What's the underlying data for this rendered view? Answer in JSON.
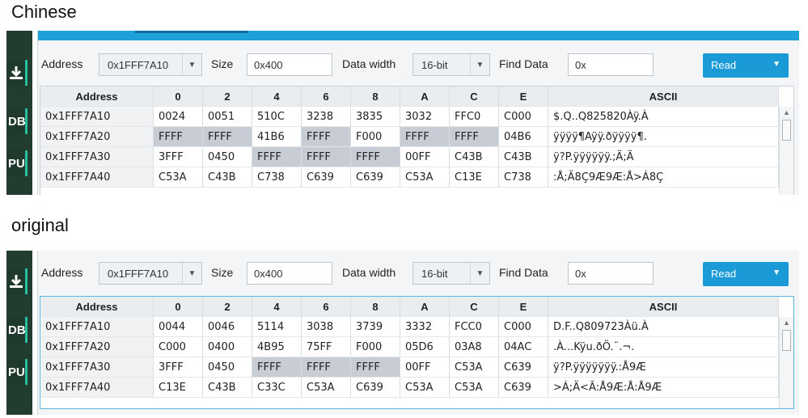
{
  "captions": {
    "top": "Chinese",
    "bottom": "original"
  },
  "sidebar_labels": {
    "db": "DB",
    "cpu": "PU"
  },
  "controls": {
    "address_label": "Address",
    "address_value": "0x1FFF7A10",
    "size_label": "Size",
    "size_value": "0x400",
    "width_label": "Data width",
    "width_value": "16-bit",
    "find_label": "Find Data",
    "find_value": "0x",
    "read_label": "Read"
  },
  "headers": [
    "Address",
    "0",
    "2",
    "4",
    "6",
    "8",
    "A",
    "C",
    "E",
    "ASCII"
  ],
  "colors": {
    "accent": "#1a9bd7",
    "highlight": "#c8ccd4",
    "sidebar": "#223d2f"
  },
  "chinese_rows": [
    {
      "addr": "0x1FFF7A10",
      "vals": [
        "0024",
        "0051",
        "510C",
        "3238",
        "3835",
        "3032",
        "FFC0",
        "C000"
      ],
      "hl": [
        false,
        false,
        false,
        false,
        false,
        false,
        false,
        false
      ],
      "ascii": "$.Q..Q825820Àÿ.À"
    },
    {
      "addr": "0x1FFF7A20",
      "vals": [
        "FFFF",
        "FFFF",
        "41B6",
        "FFFF",
        "F000",
        "FFFF",
        "FFFF",
        "04B6"
      ],
      "hl": [
        true,
        true,
        false,
        true,
        false,
        true,
        true,
        false
      ],
      "ascii": "ÿÿÿÿ¶Aÿÿ.ðÿÿÿÿ¶."
    },
    {
      "addr": "0x1FFF7A30",
      "vals": [
        "3FFF",
        "0450",
        "FFFF",
        "FFFF",
        "FFFF",
        "00FF",
        "C43B",
        "C43B"
      ],
      "hl": [
        false,
        false,
        true,
        true,
        true,
        false,
        false,
        false
      ],
      "ascii": "ÿ?P.ÿÿÿÿÿÿ.;Ä;Ä"
    },
    {
      "addr": "0x1FFF7A40",
      "vals": [
        "C53A",
        "C43B",
        "C738",
        "C639",
        "C639",
        "C53A",
        "C13E",
        "C738"
      ],
      "hl": [
        false,
        false,
        false,
        false,
        false,
        false,
        false,
        false
      ],
      "ascii": ":Å;Ä8Ç9Æ9Æ:Å>Á8Ç"
    }
  ],
  "original_rows": [
    {
      "addr": "0x1FFF7A10",
      "vals": [
        "0044",
        "0046",
        "5114",
        "3038",
        "3739",
        "3332",
        "FCC0",
        "C000"
      ],
      "hl": [
        false,
        false,
        false,
        false,
        false,
        false,
        false,
        false
      ],
      "ascii": "D.F..Q809723Àü.À"
    },
    {
      "addr": "0x1FFF7A20",
      "vals": [
        "C000",
        "0400",
        "4B95",
        "75FF",
        "F000",
        "05D6",
        "03A8",
        "04AC"
      ],
      "hl": [
        false,
        false,
        false,
        false,
        false,
        false,
        false,
        false
      ],
      "ascii": ".À...Kÿu.ðÖ.¨.¬."
    },
    {
      "addr": "0x1FFF7A30",
      "vals": [
        "3FFF",
        "0450",
        "FFFF",
        "FFFF",
        "FFFF",
        "00FF",
        "C53A",
        "C639"
      ],
      "hl": [
        false,
        false,
        true,
        true,
        true,
        false,
        false,
        false
      ],
      "ascii": "ÿ?P.ÿÿÿÿÿÿÿ.:Å9Æ"
    },
    {
      "addr": "0x1FFF7A40",
      "vals": [
        "C13E",
        "C43B",
        "C33C",
        "C53A",
        "C639",
        "C53A",
        "C53A",
        "C639"
      ],
      "hl": [
        false,
        false,
        false,
        false,
        false,
        false,
        false,
        false
      ],
      "ascii": ">Á;Ä<Ã:Å9Æ:Å:Å9Æ"
    }
  ]
}
